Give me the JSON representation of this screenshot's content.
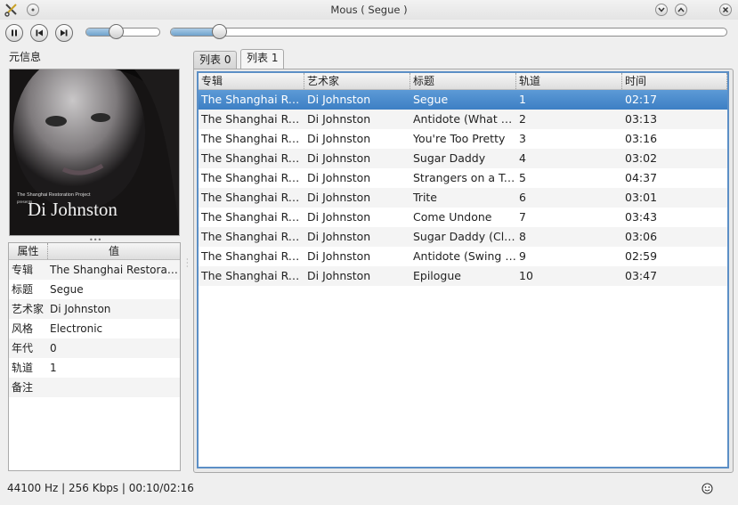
{
  "window": {
    "title": "Mous ( Segue )",
    "app_icon": "scissors-icon"
  },
  "toolbar": {
    "pause_icon": "pause-icon",
    "prev_icon": "previous-icon",
    "next_icon": "next-icon",
    "volume_level": 0.4,
    "seek_position": 0.087
  },
  "left_panel": {
    "title": "元信息",
    "cover": {
      "artist_text": "Di Johnston",
      "project_text": "The Shanghai Restoration Project",
      "presents_text": "presents"
    },
    "props_headers": [
      "属性",
      "值"
    ],
    "props": [
      {
        "key": "专辑",
        "value": "The Shanghai Restoration Project"
      },
      {
        "key": "标题",
        "value": "Segue"
      },
      {
        "key": "艺术家",
        "value": "Di Johnston"
      },
      {
        "key": "风格",
        "value": "Electronic"
      },
      {
        "key": "年代",
        "value": "0"
      },
      {
        "key": "轨道",
        "value": "1"
      },
      {
        "key": "备注",
        "value": ""
      }
    ]
  },
  "tabs": [
    {
      "label": "列表 0"
    },
    {
      "label": "列表 1"
    }
  ],
  "playlist": {
    "columns": [
      "专辑",
      "艺术家",
      "标题",
      "轨道",
      "时间"
    ],
    "rows": [
      {
        "album": "The Shanghai Restoration Project",
        "artist": "Di Johnston",
        "title": "Segue",
        "track": "1",
        "time": "02:17"
      },
      {
        "album": "The Shanghai Restoration Project",
        "artist": "Di Johnston",
        "title": "Antidote (What a Difference a Day Makes)",
        "track": "2",
        "time": "03:13"
      },
      {
        "album": "The Shanghai Restoration Project",
        "artist": "Di Johnston",
        "title": "You're Too Pretty",
        "track": "3",
        "time": "03:16"
      },
      {
        "album": "The Shanghai Restoration Project",
        "artist": "Di Johnston",
        "title": "Sugar Daddy",
        "track": "4",
        "time": "03:02"
      },
      {
        "album": "The Shanghai Restoration Project",
        "artist": "Di Johnston",
        "title": "Strangers on a Train",
        "track": "5",
        "time": "04:37"
      },
      {
        "album": "The Shanghai Restoration Project",
        "artist": "Di Johnston",
        "title": "Trite",
        "track": "6",
        "time": "03:01"
      },
      {
        "album": "The Shanghai Restoration Project",
        "artist": "Di Johnston",
        "title": "Come Undone",
        "track": "7",
        "time": "03:43"
      },
      {
        "album": "The Shanghai Restoration Project",
        "artist": "Di Johnston",
        "title": "Sugar Daddy (Club Mix)",
        "track": "8",
        "time": "03:06"
      },
      {
        "album": "The Shanghai Restoration Project",
        "artist": "Di Johnston",
        "title": "Antidote (Swing Mix)",
        "track": "9",
        "time": "02:59"
      },
      {
        "album": "The Shanghai Restoration Project",
        "artist": "Di Johnston",
        "title": "Epilogue",
        "track": "10",
        "time": "03:47"
      }
    ]
  },
  "status": {
    "text": "44100 Hz | 256 Kbps | 00:10/02:16",
    "icon": "smiley-icon"
  },
  "colors": {
    "selection": "#3d7fc4",
    "table_border": "#5c8fc6",
    "slider_fill": "#6fa2cc"
  }
}
